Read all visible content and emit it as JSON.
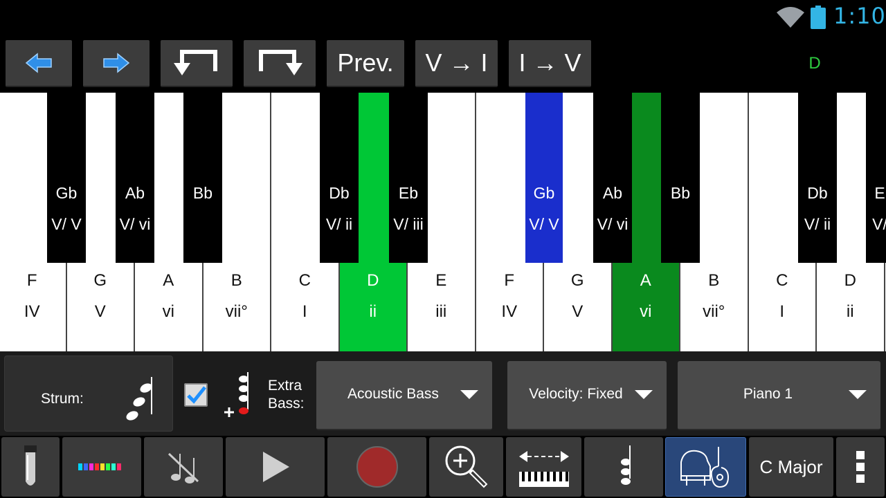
{
  "status": {
    "time": "1:10",
    "clock_color": "#33b5e5",
    "icons": [
      "wifi-icon",
      "battery-icon"
    ]
  },
  "toolbar": {
    "buttons": [
      {
        "icon": "arrow-left-icon"
      },
      {
        "icon": "arrow-right-icon"
      },
      {
        "icon": "rewind-back-icon"
      },
      {
        "icon": "forward-down-icon"
      },
      {
        "label": "Prev."
      },
      {
        "label": "V → I"
      },
      {
        "label": "I → V"
      }
    ],
    "current_key": "D",
    "current_key_color": "#2ecc40"
  },
  "keyboard": {
    "white_keys": [
      {
        "note": "F",
        "degree": "IV"
      },
      {
        "note": "G",
        "degree": "V"
      },
      {
        "note": "A",
        "degree": "vi"
      },
      {
        "note": "B",
        "degree": "vii°"
      },
      {
        "note": "C",
        "degree": "I"
      },
      {
        "note": "D",
        "degree": "ii",
        "highlight": "light-green"
      },
      {
        "note": "E",
        "degree": "iii"
      },
      {
        "note": "F",
        "degree": "IV"
      },
      {
        "note": "G",
        "degree": "V"
      },
      {
        "note": "A",
        "degree": "vi",
        "highlight": "dark-green"
      },
      {
        "note": "B",
        "degree": "vii°"
      },
      {
        "note": "C",
        "degree": "I"
      },
      {
        "note": "D",
        "degree": "ii"
      },
      {
        "note": "",
        "degree": ""
      }
    ],
    "black_keys": [
      {
        "note": "Gb",
        "degree": "V/ V"
      },
      {
        "note": "Ab",
        "degree": "V/ vi"
      },
      {
        "note": "Bb",
        "degree": ""
      },
      {
        "note": "Db",
        "degree": "V/ ii"
      },
      {
        "note": "Eb",
        "degree": "V/ iii"
      },
      {
        "note": "Gb",
        "degree": "V/ V",
        "highlight": "blue"
      },
      {
        "note": "Ab",
        "degree": "V/ vi"
      },
      {
        "note": "Bb",
        "degree": ""
      },
      {
        "note": "Db",
        "degree": "V/ ii"
      },
      {
        "note": "E",
        "degree": "V/"
      }
    ],
    "highlight_colors": {
      "light_green": "#00c736",
      "dark_green": "#0a8a1e",
      "blue": "#1a2ecc"
    }
  },
  "controls": {
    "strum_label": "Strum:",
    "strum_icon": "arpeggio-note-icon",
    "extra_bass_checked": true,
    "extra_bass_icon": "plus-bass-note-icon",
    "extra_bass_label_line1": "Extra",
    "extra_bass_label_line2": "Bass:",
    "bass_instrument": "Acoustic Bass",
    "velocity": "Velocity: Fixed",
    "instrument": "Piano 1"
  },
  "bottom_bar": {
    "buttons": [
      {
        "icon": "test-tube-icon"
      },
      {
        "icon": "color-bars-icon"
      },
      {
        "icon": "no-notes-icon"
      },
      {
        "icon": "play-icon"
      },
      {
        "icon": "record-icon"
      },
      {
        "icon": "zoom-icon"
      },
      {
        "icon": "scroll-keyboard-icon"
      },
      {
        "icon": "chord-note-icon"
      },
      {
        "icon": "piano-guitar-icon",
        "active": true
      },
      {
        "label": "C Major"
      },
      {
        "icon": "overflow-menu-icon"
      }
    ]
  }
}
